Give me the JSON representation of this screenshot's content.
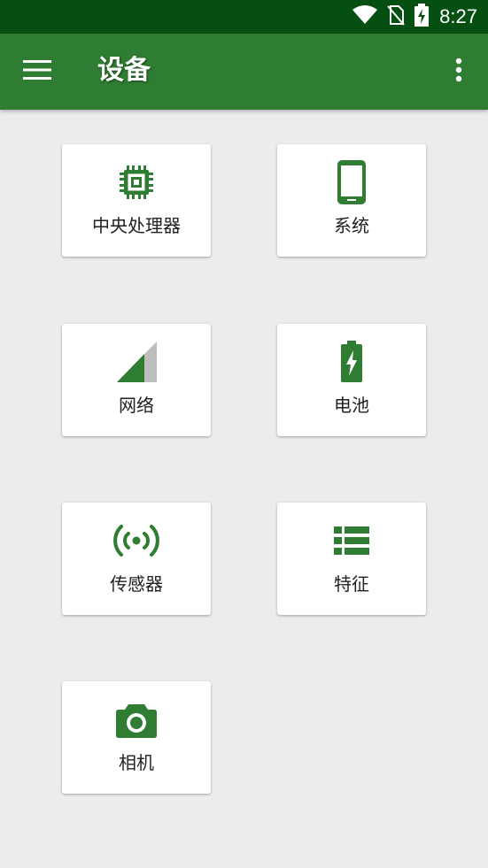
{
  "status_bar": {
    "time": "8:27",
    "icons": [
      "wifi-icon",
      "no-sim-icon",
      "battery-charging-icon"
    ]
  },
  "app_bar": {
    "title": "设备",
    "icons": [
      "menu-icon",
      "more-vert-icon"
    ]
  },
  "colors": {
    "status_bar": "#064f12",
    "app_bar": "#2e7d32",
    "icon": "#2e7d32",
    "background": "#ececec"
  },
  "tiles": [
    {
      "label": "中央处理器",
      "icon": "cpu-icon"
    },
    {
      "label": "系统",
      "icon": "phone-icon"
    },
    {
      "label": "网络",
      "icon": "signal-icon"
    },
    {
      "label": "电池",
      "icon": "battery-icon"
    },
    {
      "label": "传感器",
      "icon": "sensor-icon"
    },
    {
      "label": "特征",
      "icon": "list-icon"
    },
    {
      "label": "相机",
      "icon": "camera-icon"
    }
  ]
}
